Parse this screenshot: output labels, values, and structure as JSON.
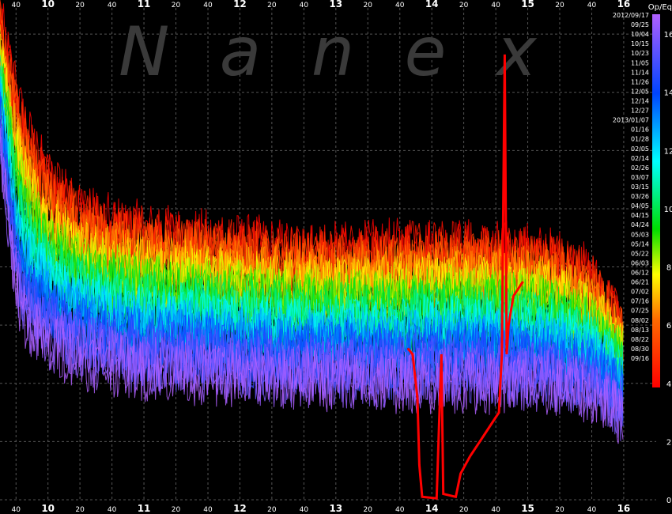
{
  "chart_data": {
    "type": "line",
    "watermark": "N a n e x",
    "x_axis": {
      "ticks": [
        {
          "label": "40",
          "t": 9.667
        },
        {
          "label": "10",
          "t": 10.0
        },
        {
          "label": "20",
          "t": 10.333
        },
        {
          "label": "40",
          "t": 10.667
        },
        {
          "label": "11",
          "t": 11.0
        },
        {
          "label": "20",
          "t": 11.333
        },
        {
          "label": "40",
          "t": 11.667
        },
        {
          "label": "12",
          "t": 12.0
        },
        {
          "label": "20",
          "t": 12.333
        },
        {
          "label": "40",
          "t": 12.667
        },
        {
          "label": "13",
          "t": 13.0
        },
        {
          "label": "20",
          "t": 13.333
        },
        {
          "label": "40",
          "t": 13.667
        },
        {
          "label": "14",
          "t": 14.0
        },
        {
          "label": "20",
          "t": 14.333
        },
        {
          "label": "40",
          "t": 14.667
        },
        {
          "label": "15",
          "t": 15.0
        },
        {
          "label": "20",
          "t": 15.333
        },
        {
          "label": "40",
          "t": 15.667
        },
        {
          "label": "16",
          "t": 16.0
        }
      ],
      "range": [
        9.5,
        16.05
      ]
    },
    "y_axis": {
      "label": "Op/Eq",
      "ticks": [
        0,
        2,
        4,
        6,
        8,
        10,
        12,
        14,
        16
      ],
      "range": [
        0,
        16.9
      ]
    },
    "color_scale": [
      {
        "value": 0,
        "color": "#ff0000"
      },
      {
        "value": 3,
        "color": "#ff6a00"
      },
      {
        "value": 5,
        "color": "#ffff00"
      },
      {
        "value": 7,
        "color": "#00dd00"
      },
      {
        "value": 10,
        "color": "#00ffff"
      },
      {
        "value": 13,
        "color": "#0044ff"
      },
      {
        "value": 16.5,
        "color": "#b060ff"
      }
    ],
    "legend_dates": [
      "2012/09/17",
      "09/25",
      "10/04",
      "10/15",
      "10/23",
      "11/05",
      "11/14",
      "11/26",
      "12/05",
      "12/14",
      "12/27",
      "2013/01/07",
      "01/16",
      "01/28",
      "02/05",
      "02/14",
      "02/26",
      "03/07",
      "03/15",
      "03/26",
      "04/05",
      "04/15",
      "04/24",
      "05/03",
      "05/14",
      "05/22",
      "06/03",
      "06/12",
      "06/21",
      "07/02",
      "07/16",
      "07/25",
      "08/02",
      "08/13",
      "08/22",
      "08/30",
      "09/16"
    ],
    "series_profile": {
      "t": [
        9.5,
        9.6,
        9.7,
        9.8,
        10.0,
        10.3,
        10.6,
        11.0,
        11.5,
        12.0,
        12.5,
        13.0,
        13.5,
        14.0,
        14.5,
        15.0,
        15.3,
        15.6,
        15.8,
        16.0
      ],
      "top": [
        16.5,
        15.0,
        13.5,
        12.5,
        11.0,
        10.0,
        9.5,
        9.2,
        9.0,
        8.8,
        8.6,
        8.5,
        8.6,
        8.7,
        8.6,
        8.5,
        8.3,
        7.8,
        7.0,
        5.8
      ],
      "bottom": [
        11.5,
        8.0,
        5.5,
        4.8,
        4.3,
        4.0,
        3.8,
        3.6,
        3.5,
        3.4,
        3.3,
        3.3,
        3.2,
        3.2,
        3.2,
        3.2,
        3.1,
        3.0,
        2.7,
        2.3
      ]
    },
    "highlight_series": {
      "color": "#ff0000",
      "points": [
        [
          13.75,
          5.2
        ],
        [
          13.8,
          5.0
        ],
        [
          13.85,
          3.5
        ],
        [
          13.87,
          1.2
        ],
        [
          13.9,
          0.1
        ],
        [
          14.05,
          0.05
        ],
        [
          14.1,
          5.0
        ],
        [
          14.12,
          0.2
        ],
        [
          14.25,
          0.1
        ],
        [
          14.3,
          0.9
        ],
        [
          14.4,
          1.5
        ],
        [
          14.5,
          2.0
        ],
        [
          14.6,
          2.5
        ],
        [
          14.7,
          3.0
        ],
        [
          14.73,
          5.0
        ],
        [
          14.76,
          15.3
        ],
        [
          14.78,
          5.0
        ],
        [
          14.8,
          6.0
        ],
        [
          14.85,
          7.0
        ],
        [
          14.95,
          7.5
        ]
      ]
    }
  }
}
